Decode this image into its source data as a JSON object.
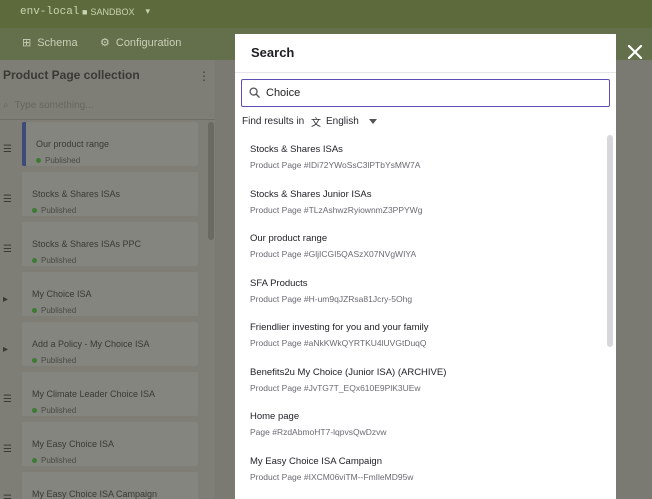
{
  "app": {
    "env": "env-local",
    "badge": "SANDBOX"
  },
  "nav": {
    "schema": "Schema",
    "configuration": "Configuration"
  },
  "collection": {
    "title": "Product Page collection",
    "search_placeholder": "Type something...",
    "items": [
      {
        "name": "Our product range",
        "status": "Published"
      },
      {
        "name": "Stocks & Shares ISAs",
        "status": "Published"
      },
      {
        "name": "Stocks & Shares ISAs PPC",
        "status": "Published"
      },
      {
        "name": "My Choice ISA",
        "status": "Published"
      },
      {
        "name": "Add a Policy - My Choice ISA",
        "status": "Published"
      },
      {
        "name": "My Climate Leader Choice ISA",
        "status": "Published"
      },
      {
        "name": "My Easy Choice ISA",
        "status": "Published"
      },
      {
        "name": "My Easy Choice ISA Campaign",
        "status": ""
      }
    ]
  },
  "modal": {
    "title": "Search",
    "query": "Choice",
    "find_label": "Find results in",
    "language": "English",
    "results": [
      {
        "title": "Stocks & Shares ISAs",
        "sub": "Product Page #IDi72YWoSsC3lPTbYsMW7A"
      },
      {
        "title": "Stocks & Shares Junior ISAs",
        "sub": "Product Page #TLzAshwzRyiownmZ3PPYWg"
      },
      {
        "title": "Our product range",
        "sub": "Product Page #GljICGI5QASzX07NVgWIYA"
      },
      {
        "title": "SFA Products",
        "sub": "Product Page #H-um9qJZRsa81Jcry-5Ohg"
      },
      {
        "title": "Friendlier investing for you and your family",
        "sub": "Product Page #aNkKWkQYRTKU4lUVGtDuqQ"
      },
      {
        "title": "Benefits2u My Choice (Junior ISA) (ARCHIVE)",
        "sub": "Product Page #JvTG7T_EQx610E9PlK3UEw"
      },
      {
        "title": "Home page",
        "sub": "Page #RzdAbmoHT7-lqpvsQwDzvw"
      },
      {
        "title": "My Easy Choice ISA Campaign",
        "sub": "Product Page #IXCM06viTM--FmIleMD95w"
      }
    ]
  },
  "colors": {
    "accent": "#5b4fb5",
    "topbar": "#5d6b3c",
    "published": "#3d7a32"
  },
  "icons": {
    "close": "close-icon",
    "search": "search-icon",
    "language": "translate-icon"
  }
}
